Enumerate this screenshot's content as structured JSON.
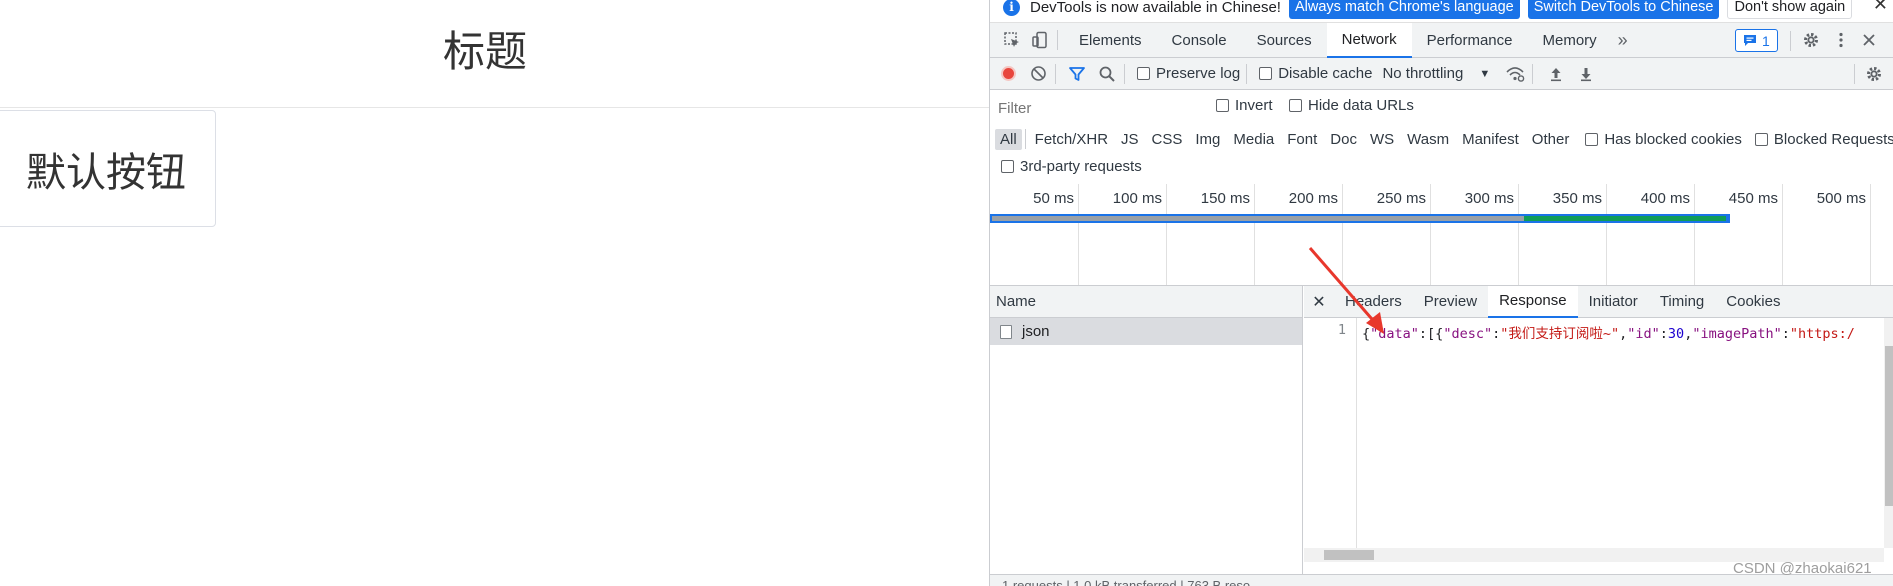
{
  "page": {
    "title": "标题",
    "button_label": "默认按钮"
  },
  "devtools": {
    "infobar": {
      "text": "DevTools is now available in Chinese!",
      "btn_match": "Always match Chrome's language",
      "btn_switch": "Switch DevTools to Chinese",
      "btn_dismiss": "Don't show again",
      "close": "✕"
    },
    "tabs": [
      "Elements",
      "Console",
      "Sources",
      "Network",
      "Performance",
      "Memory"
    ],
    "active_tab": "Network",
    "more_tabs": "»",
    "message_count": "1",
    "toolbar": {
      "preserve_log": "Preserve log",
      "disable_cache": "Disable cache",
      "throttling": "No throttling"
    },
    "filter": {
      "placeholder": "Filter",
      "invert": "Invert",
      "hide_data_urls": "Hide data URLs",
      "types": [
        "All",
        "Fetch/XHR",
        "JS",
        "CSS",
        "Img",
        "Media",
        "Font",
        "Doc",
        "WS",
        "Wasm",
        "Manifest",
        "Other"
      ],
      "active_type": "All",
      "has_blocked_cookies": "Has blocked cookies",
      "blocked_requests": "Blocked Requests",
      "third_party": "3rd-party requests"
    },
    "timeline": {
      "labels": [
        "50 ms",
        "100 ms",
        "150 ms",
        "200 ms",
        "250 ms",
        "300 ms",
        "350 ms",
        "400 ms",
        "450 ms",
        "500 ms"
      ]
    },
    "requests": {
      "name_header": "Name",
      "rows": [
        {
          "name": "json"
        }
      ]
    },
    "detail": {
      "close": "✕",
      "tabs": [
        "Headers",
        "Preview",
        "Response",
        "Initiator",
        "Timing",
        "Cookies"
      ],
      "active_tab": "Response",
      "line_number": "1",
      "response": {
        "p1": "{",
        "k_data": "\"data\"",
        "p2": ":[{",
        "k_desc": "\"desc\"",
        "p3": ":",
        "v_desc": "\"我们支持订阅啦~\"",
        "p4": ",",
        "k_id": "\"id\"",
        "p5": ":",
        "v_id": "30",
        "p6": ",",
        "k_image": "\"imagePath\"",
        "p7": ":",
        "v_image": "\"https:/"
      }
    },
    "status": "1 requests  |  1.0 kB transferred  |  763 B reso",
    "watermark": "CSDN @zhaokai621"
  },
  "colors": {
    "accent": "#1a73e8",
    "record": "#e8453c",
    "arrow": "#e8372c"
  }
}
